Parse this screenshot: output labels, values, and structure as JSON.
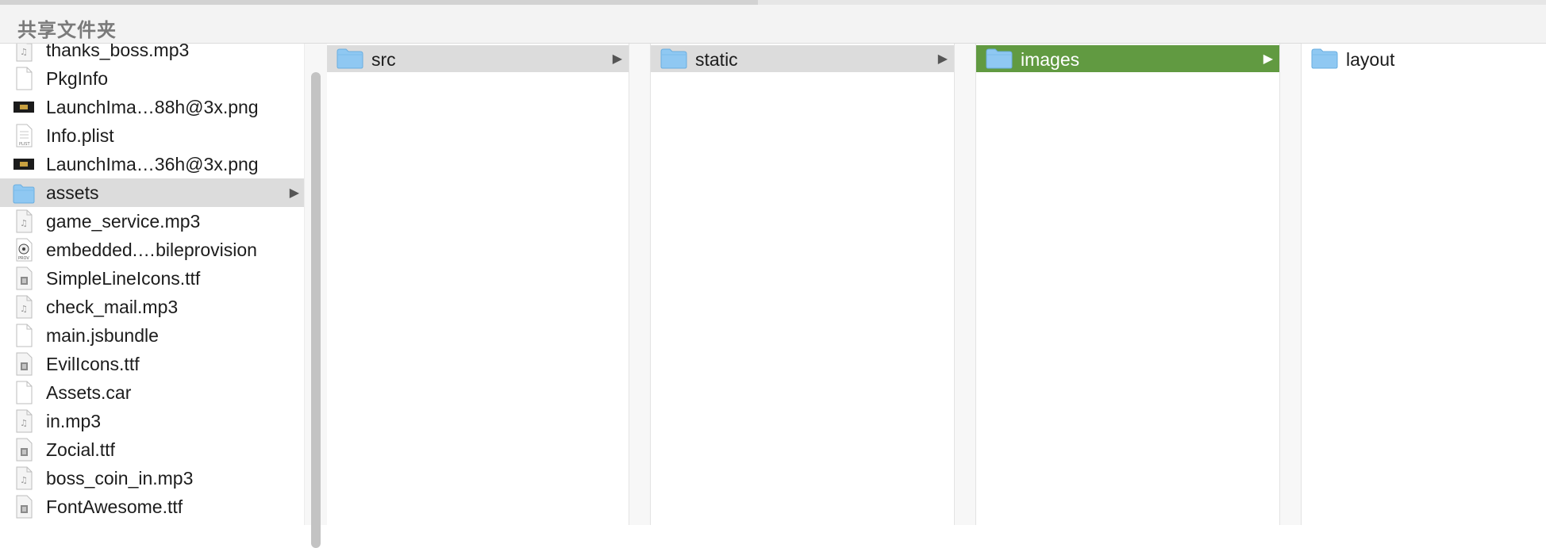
{
  "section": {
    "title": "共享文件夹"
  },
  "sidebar": {
    "items": [
      {
        "label": "thanks_boss.mp3",
        "icon": "audio-file-icon"
      },
      {
        "label": "PkgInfo",
        "icon": "blank-file-icon"
      },
      {
        "label": "LaunchIma…88h@3x.png",
        "icon": "image-file-icon"
      },
      {
        "label": "Info.plist",
        "icon": "plist-file-icon"
      },
      {
        "label": "LaunchIma…36h@3x.png",
        "icon": "image-file-icon"
      },
      {
        "label": "assets",
        "icon": "folder-icon",
        "selected": true
      },
      {
        "label": "game_service.mp3",
        "icon": "audio-file-icon"
      },
      {
        "label": "embedded.…bileprovision",
        "icon": "provision-file-icon"
      },
      {
        "label": "SimpleLineIcons.ttf",
        "icon": "font-file-icon"
      },
      {
        "label": "check_mail.mp3",
        "icon": "audio-file-icon"
      },
      {
        "label": "main.jsbundle",
        "icon": "blank-file-icon"
      },
      {
        "label": "EvilIcons.ttf",
        "icon": "font-file-icon"
      },
      {
        "label": "Assets.car",
        "icon": "blank-file-icon"
      },
      {
        "label": "in.mp3",
        "icon": "audio-file-icon"
      },
      {
        "label": "Zocial.ttf",
        "icon": "font-file-icon"
      },
      {
        "label": "boss_coin_in.mp3",
        "icon": "audio-file-icon"
      },
      {
        "label": "FontAwesome.ttf",
        "icon": "font-file-icon"
      }
    ]
  },
  "columns": [
    {
      "label": "src",
      "icon": "folder-icon"
    },
    {
      "label": "static",
      "icon": "folder-icon"
    },
    {
      "label": "images",
      "icon": "folder-icon"
    },
    {
      "label": "layout",
      "icon": "folder-icon"
    }
  ],
  "colors": {
    "selection_active": "#619a41",
    "selection_inactive": "#dcdcdc",
    "folder": "#8fc8f2"
  }
}
